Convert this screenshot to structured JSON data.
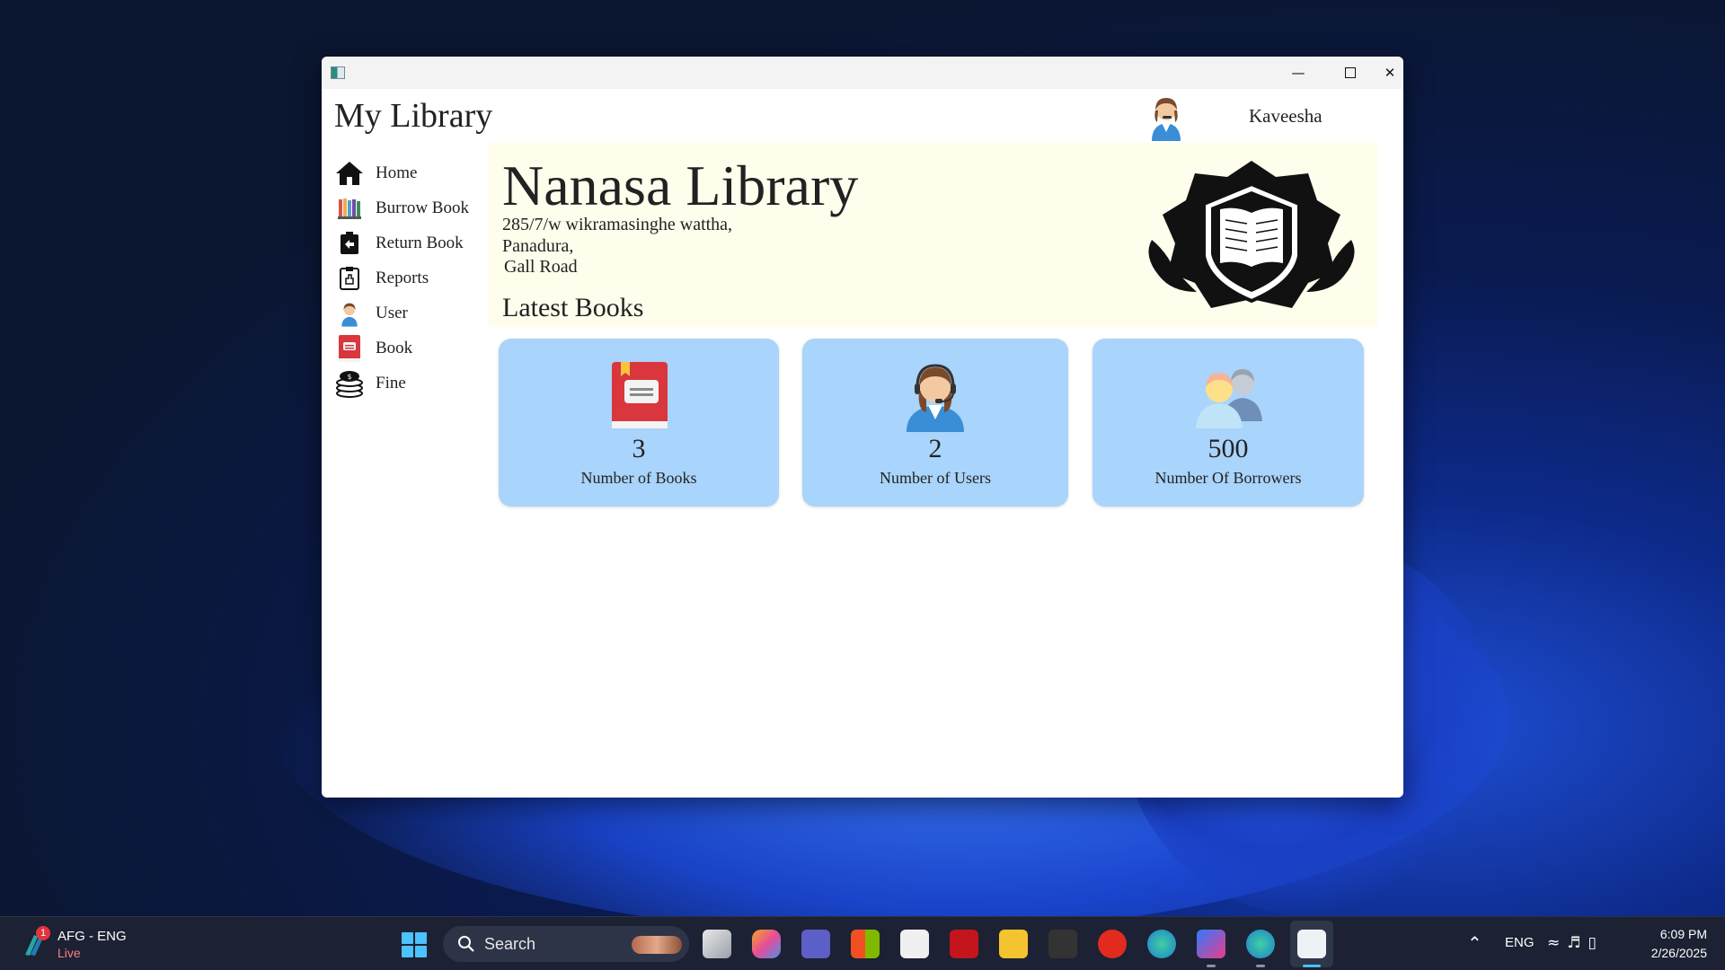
{
  "window": {
    "app_title": "My Library",
    "user_name": "Kaveesha"
  },
  "sidebar": {
    "items": [
      {
        "label": "Home",
        "icon": "home-icon"
      },
      {
        "label": "Burrow Book",
        "icon": "books-icon"
      },
      {
        "label": "Return Book",
        "icon": "return-book-icon"
      },
      {
        "label": "Reports",
        "icon": "reports-icon"
      },
      {
        "label": "User",
        "icon": "user-icon"
      },
      {
        "label": "Book",
        "icon": "book-icon"
      },
      {
        "label": "Fine",
        "icon": "coins-icon"
      }
    ]
  },
  "banner": {
    "library_name": "Nanasa Library",
    "address_line1": "285/7/w wikramasinghe wattha,",
    "address_line2": "Panadura,",
    "address_line3": "Gall Road",
    "section_title": "Latest Books"
  },
  "cards": [
    {
      "number": "3",
      "label": "Number of Books",
      "icon": "book-icon"
    },
    {
      "number": "2",
      "label": "Number of Users",
      "icon": "support-agent-icon"
    },
    {
      "number": "500",
      "label": "Number Of Borrowers",
      "icon": "users-group-icon"
    }
  ],
  "taskbar": {
    "weather_badge": "1",
    "weather_title": "AFG - ENG",
    "weather_sub": "Live",
    "search_placeholder": "Search",
    "language": "ENG",
    "time": "6:09 PM",
    "date": "2/26/2025"
  },
  "colors": {
    "banner_bg": "#fffdec",
    "card_bg": "#a9d4fb",
    "taskbar_bg": "#1c2233"
  }
}
